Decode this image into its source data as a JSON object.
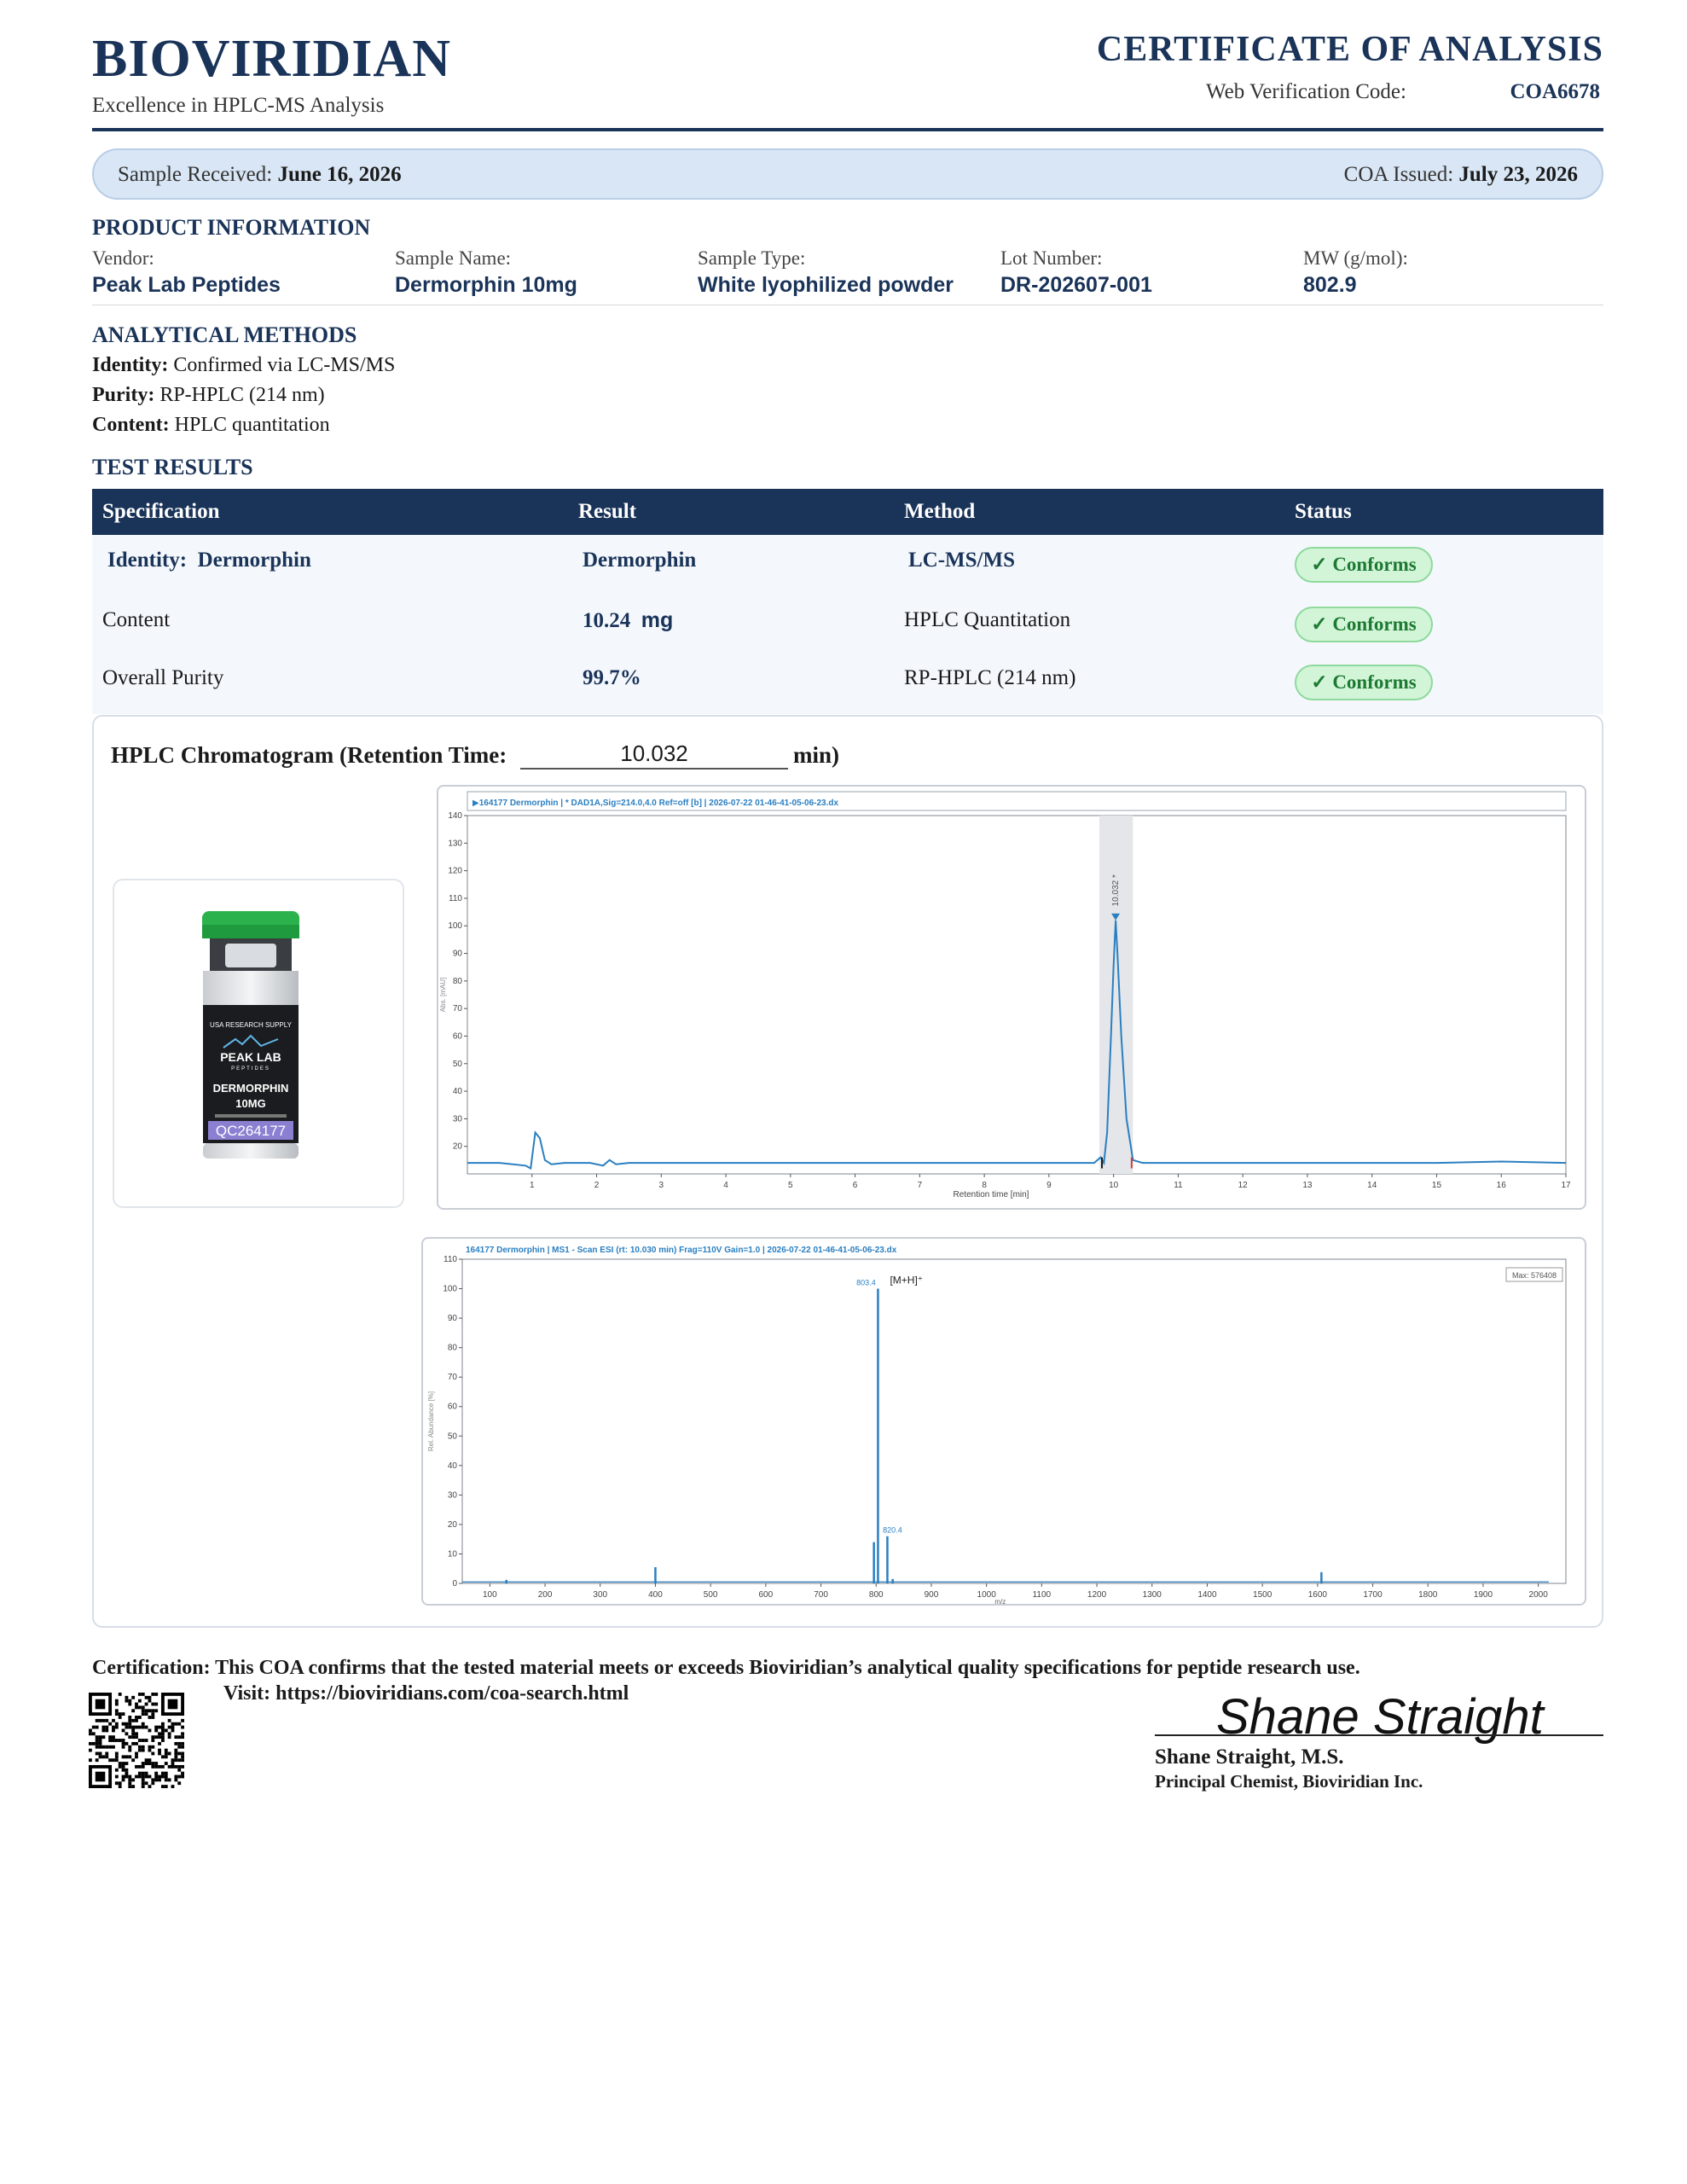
{
  "header": {
    "brand": "BIOVIRIDIAN",
    "tagline": "Excellence in HPLC-MS Analysis",
    "doc_title": "CERTIFICATE OF ANALYSIS",
    "verification_label": "Web Verification Code:",
    "verification_code": "COA6678"
  },
  "dates": {
    "received_label": "Sample Received:",
    "received_value": "June 16, 2026",
    "issued_label": "COA Issued:",
    "issued_value": "July 23, 2026"
  },
  "product_info": {
    "heading": "PRODUCT INFORMATION",
    "fields": [
      {
        "label": "Vendor:",
        "value": "Peak Lab Peptides"
      },
      {
        "label": "Sample Name:",
        "value": "Dermorphin 10mg"
      },
      {
        "label": "Sample Type:",
        "value": "White lyophilized powder"
      },
      {
        "label": "Lot Number:",
        "value": "DR-202607-001"
      },
      {
        "label": "MW (g/mol):",
        "value": "802.9"
      }
    ]
  },
  "methods": {
    "heading": "ANALYTICAL METHODS",
    "items": [
      {
        "label": "Identity:",
        "value": "Confirmed via LC-MS/MS"
      },
      {
        "label": "Purity:",
        "value": "RP-HPLC (214 nm)"
      },
      {
        "label": "Content:",
        "value": "HPLC quantitation"
      }
    ]
  },
  "results": {
    "heading": "TEST RESULTS",
    "columns": [
      "Specification",
      "Result",
      "Method",
      "Status"
    ],
    "rows": [
      {
        "spec_label": "Identity:",
        "spec_value": "Dermorphin",
        "result": "Dermorphin",
        "result_unit": "",
        "method": "LC-MS/MS",
        "status": "Conforms"
      },
      {
        "spec_label": "Content",
        "spec_value": "",
        "result": "10.24",
        "result_unit": "mg",
        "method": "HPLC Quantitation",
        "status": "Conforms"
      },
      {
        "spec_label": "Overall Purity",
        "spec_value": "",
        "result": "99.7%",
        "result_unit": "",
        "method": "RP-HPLC (214 nm)",
        "status": "Conforms"
      }
    ],
    "check_glyph": "✓"
  },
  "chromatogram": {
    "title": "HPLC Chromatogram (Retention Time:",
    "retention_time": "10.032",
    "unit_suffix": "min)"
  },
  "vial": {
    "brand_line": "USA RESEARCH SUPPLY",
    "logo_top": "PEAK LAB",
    "logo_bottom": "PEPTIDES",
    "product": "DERMORPHIN",
    "strength": "10MG",
    "qc": "QC264177",
    "cap_color": "#2bb24c"
  },
  "chart_data": [
    {
      "type": "line",
      "title": "164177 Dermorphin | * DAD1A,Sig=214.0,4.0 Ref=off [b] | 2026-07-22 01-46-41-05-06-23.dx",
      "xlabel": "Retention time [min]",
      "ylabel": "Abs. [mAU]",
      "xlim": [
        0,
        17
      ],
      "ylim": [
        10,
        140
      ],
      "x_ticks": [
        1,
        2,
        3,
        4,
        5,
        6,
        7,
        8,
        9,
        10,
        11,
        12,
        13,
        14,
        15,
        16,
        17
      ],
      "y_ticks": [
        20,
        30,
        40,
        50,
        60,
        70,
        80,
        90,
        100,
        110,
        120,
        130,
        140
      ],
      "peak_label": "10.032",
      "series": [
        {
          "x": [
            0,
            0.5,
            0.9,
            0.98,
            1.05,
            1.12,
            1.2,
            1.3,
            1.5,
            1.9,
            2.1,
            2.2,
            2.3,
            2.5,
            3,
            5,
            8,
            9.7,
            9.8,
            9.85,
            9.9,
            9.96,
            10.0,
            10.032,
            10.06,
            10.12,
            10.2,
            10.3,
            10.45,
            11,
            13,
            15,
            16,
            17
          ],
          "y": [
            14,
            14,
            13,
            12,
            25,
            23,
            15,
            13.5,
            14,
            14,
            13,
            15,
            13.5,
            14,
            14,
            14,
            14,
            14,
            16,
            14,
            25,
            60,
            85,
            102,
            90,
            60,
            30,
            15,
            14,
            14,
            14,
            14,
            14.5,
            14
          ]
        }
      ]
    },
    {
      "type": "line",
      "title": "164177 Dermorphin | MS1 - Scan ESI (rt: 10.030 min) Frag=110V Gain=1.0 | 2026-07-22 01-46-41-05-06-23.dx",
      "xlabel": "m/z",
      "ylabel": "Rel. Abundance [%]",
      "xlim": [
        50,
        2050
      ],
      "ylim": [
        0,
        110
      ],
      "x_ticks": [
        100,
        200,
        300,
        400,
        500,
        600,
        700,
        800,
        900,
        1000,
        1100,
        1200,
        1300,
        1400,
        1500,
        1600,
        1700,
        1800,
        1900,
        2000
      ],
      "y_ticks": [
        0,
        10,
        20,
        30,
        40,
        50,
        60,
        70,
        80,
        90,
        100,
        110
      ],
      "max_label": "Max: 576408",
      "peak_annotation": "[M+H]⁺",
      "peaks": [
        {
          "x": 130,
          "y": 1.2
        },
        {
          "x": 400,
          "y": 5.5
        },
        {
          "x": 796,
          "y": 14
        },
        {
          "x": 803.4,
          "y": 100,
          "label": "803.4"
        },
        {
          "x": 820.4,
          "y": 16,
          "label": "820.4"
        },
        {
          "x": 830,
          "y": 1.5
        },
        {
          "x": 1607,
          "y": 3.8
        }
      ]
    }
  ],
  "footer": {
    "certification": "Certification: This COA confirms that the tested material meets or exceeds Bioviridian’s analytical quality specifications for peptide research use.",
    "visit": "Visit: https://bioviridians.com/coa-search.html",
    "signature_script": "Shane Straight",
    "signer_name": "Shane Straight, M.S.",
    "signer_title": "Principal Chemist, Bioviridian Inc."
  },
  "colors": {
    "navy": "#1a3358",
    "accent_blue": "#2a7fc1",
    "conforms_green": "#1d7a33",
    "conforms_bg": "#d2f5d8"
  }
}
